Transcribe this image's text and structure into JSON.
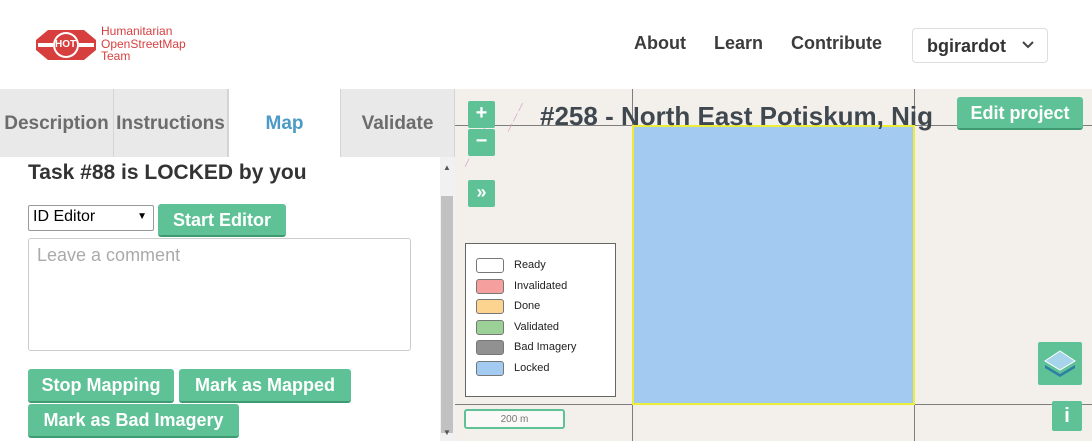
{
  "header": {
    "logo_badge": "HOT",
    "logo_line1": "Humanitarian",
    "logo_line2": "OpenStreetMap",
    "logo_line3": "Team",
    "nav": [
      "About",
      "Learn",
      "Contribute"
    ],
    "user": "bgirardot"
  },
  "tabs": [
    "Description",
    "Instructions",
    "Map",
    "Validate"
  ],
  "active_tab": "Map",
  "task": {
    "title": "Task #88 is LOCKED by you",
    "editor_selected": "ID Editor",
    "start_editor": "Start Editor",
    "comment_placeholder": "Leave a comment",
    "stop_mapping": "Stop Mapping",
    "mark_mapped": "Mark as Mapped",
    "mark_bad": "Mark as Bad Imagery"
  },
  "map": {
    "project_title": "#258 - North East Potiskum, Nig",
    "edit_project": "Edit project",
    "zoom_in": "+",
    "zoom_out": "−",
    "expand": "»",
    "info": "i",
    "scale": "200 m",
    "legend": [
      {
        "label": "Ready",
        "color": "#ffffff"
      },
      {
        "label": "Invalidated",
        "color": "#f59f9f"
      },
      {
        "label": "Done",
        "color": "#fcd38f"
      },
      {
        "label": "Validated",
        "color": "#9bd196"
      },
      {
        "label": "Bad Imagery",
        "color": "#919191"
      },
      {
        "label": "Locked",
        "color": "#a3cbf2"
      }
    ]
  },
  "colors": {
    "accent": "#5ec296",
    "brand_red": "#d73f3f",
    "active_tab": "#4c9ac6",
    "locked_fill": "#a3cbf2",
    "task_border": "#ecec39"
  }
}
